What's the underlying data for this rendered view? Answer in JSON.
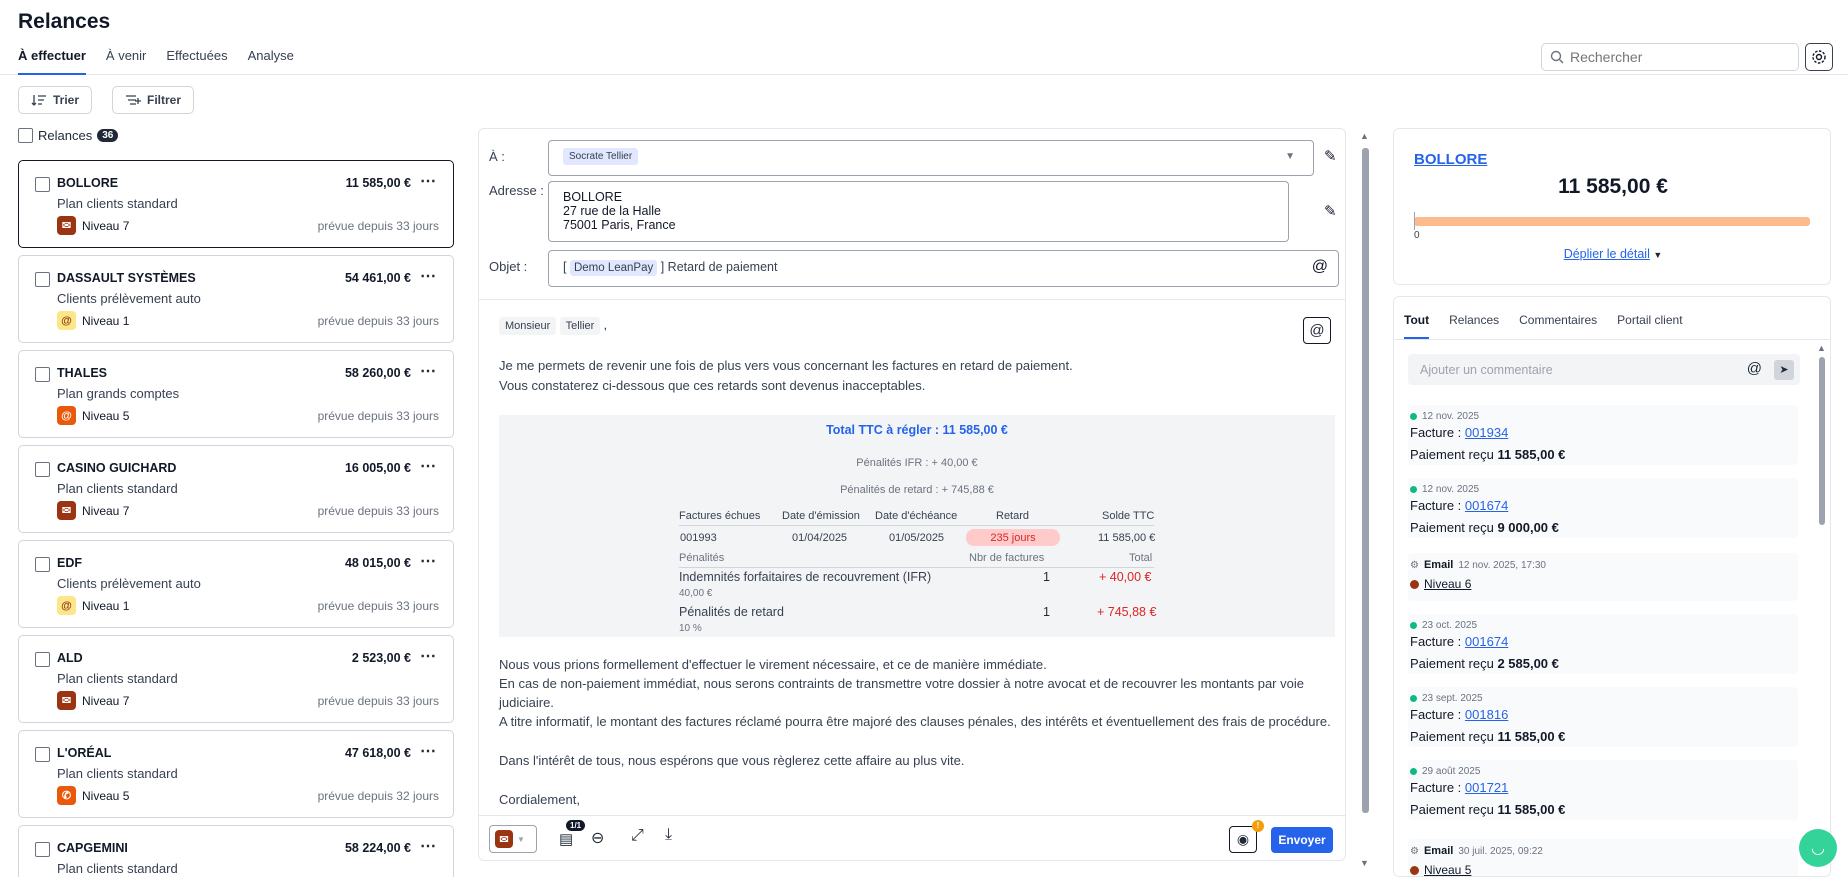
{
  "header": {
    "title": "Relances",
    "tabs": [
      "À effectuer",
      "À venir",
      "Effectuées",
      "Analyse"
    ],
    "search_placeholder": "Rechercher"
  },
  "toolbar": {
    "sort": "Trier",
    "filter": "Filtrer"
  },
  "list": {
    "label": "Relances",
    "count": "36",
    "items": [
      {
        "name": "BOLLORE",
        "amount": "11 585,00 €",
        "plan": "Plan clients standard",
        "level": "Niveau 7",
        "due": "prévue depuis 33 jours"
      },
      {
        "name": "DASSAULT SYSTÈMES",
        "amount": "54 461,00 €",
        "plan": "Clients prélèvement auto",
        "level": "Niveau 1",
        "due": "prévue depuis 33 jours"
      },
      {
        "name": "THALES",
        "amount": "58 260,00 €",
        "plan": "Plan grands comptes",
        "level": "Niveau 5",
        "due": "prévue depuis 33 jours"
      },
      {
        "name": "CASINO GUICHARD",
        "amount": "16 005,00 €",
        "plan": "Plan clients standard",
        "level": "Niveau 7",
        "due": "prévue depuis 33 jours"
      },
      {
        "name": "EDF",
        "amount": "48 015,00 €",
        "plan": "Clients prélèvement auto",
        "level": "Niveau 1",
        "due": "prévue depuis 33 jours"
      },
      {
        "name": "ALD",
        "amount": "2 523,00 €",
        "plan": "Plan clients standard",
        "level": "Niveau 7",
        "due": "prévue depuis 33 jours"
      },
      {
        "name": "L'ORÉAL",
        "amount": "47 618,00 €",
        "plan": "Plan clients standard",
        "level": "Niveau 5",
        "due": "prévue depuis 32 jours"
      },
      {
        "name": "CAPGEMINI",
        "amount": "58 224,00 €",
        "plan": "Plan clients standard",
        "level": "",
        "due": ""
      }
    ]
  },
  "composer": {
    "to_label": "À :",
    "to_chip": "Socrate Tellier",
    "address_label": "Adresse :",
    "address": [
      "BOLLORE",
      "27 rue de la Halle",
      "75001 Paris, France"
    ],
    "subject_label": "Objet :",
    "subject_prefix": "[",
    "subject_chip": "Demo LeanPay",
    "subject_rest": "] Retard de paiement",
    "greeting_chip1": "Monsieur",
    "greeting_chip2": "Tellier",
    "greeting_end": ",",
    "p1": "Je me permets de revenir une fois de plus vers vous concernant les factures en retard de paiement.",
    "p2": "Vous constaterez ci-dessous que ces retards sont devenus inacceptables.",
    "total": "Total TTC à régler : 11 585,00 €",
    "ifr_line": "Pénalités IFR : + 40,00 €",
    "late_line": "Pénalités de retard : + 745,88 €",
    "cols": [
      "Factures échues",
      "Date d'émission",
      "Date d'échéance",
      "Retard",
      "Solde TTC"
    ],
    "row": [
      "001993",
      "01/04/2025",
      "01/05/2025",
      "235 jours",
      "11 585,00 €"
    ],
    "pen_cols": [
      "Pénalités",
      "Nbr de factures",
      "Total"
    ],
    "pen1": {
      "name": "Indemnités forfaitaires de recouvrement (IFR)",
      "sub": "40,00 €",
      "n": "1",
      "total": "+ 40,00 €"
    },
    "pen2": {
      "name": "Pénalités de retard",
      "sub": "10 %",
      "n": "1",
      "total": "+ 745,88 €"
    },
    "p3": "Nous vous prions formellement d'effectuer le virement nécessaire, et ce de manière immédiate.",
    "p4": "En cas de non-paiement immédiat, nous serons contraints de transmettre votre dossier à notre avocat et de recouvrer les montants par voie",
    "p4b": "judiciaire.",
    "p5": "A titre informatif, le montant des factures réclamé pourra être majoré des clauses pénales, des intérêts et éventuellement des frais de procédure.",
    "p6": "Dans l'intérêt de tous, nous espérons que vous règlerez cette affaire au plus vite.",
    "p7": "Cordialement,",
    "attach_count": "1/1",
    "notif": "!",
    "send": "Envoyer"
  },
  "summary": {
    "client": "BOLLORE",
    "amount": "11 585,00 €",
    "axis0": "0",
    "expand": "Déplier le détail"
  },
  "activity": {
    "tabs": [
      "Tout",
      "Relances",
      "Commentaires",
      "Portail client"
    ],
    "comment_placeholder": "Ajouter un commentaire",
    "events": [
      {
        "date": "12 nov. 2025",
        "l1": "Facture : ",
        "link": "001934",
        "l2": "Paiement reçu ",
        "amt": "11 585,00 €"
      },
      {
        "date": "12 nov. 2025",
        "l1": "Facture : ",
        "link": "001674",
        "l2": "Paiement reçu ",
        "amt": "9 000,00 €"
      },
      {
        "date": "12 nov. 2025, 17:30",
        "type": "Email",
        "level": "Niveau 6"
      },
      {
        "date": "23 oct. 2025",
        "l1": "Facture : ",
        "link": "001674",
        "l2": "Paiement reçu ",
        "amt": "2 585,00 €"
      },
      {
        "date": "23 sept. 2025",
        "l1": "Facture : ",
        "link": "001816",
        "l2": "Paiement reçu ",
        "amt": "11 585,00 €"
      },
      {
        "date": "29 août 2025",
        "l1": "Facture : ",
        "link": "001721",
        "l2": "Paiement reçu ",
        "amt": "11 585,00 €"
      },
      {
        "date": "30 juil. 2025, 09:22",
        "type": "Email",
        "level": "Niveau 5"
      }
    ]
  },
  "colors": {
    "accent": "#2563eb",
    "level7": "#9a3412",
    "level1": "#fde68a",
    "level5": "#ea580c",
    "progress": "#fdba8c",
    "green": "#10b981"
  }
}
